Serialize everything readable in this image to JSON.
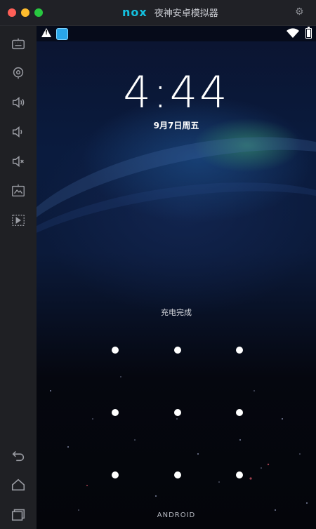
{
  "window": {
    "brand_logo": "nox",
    "title": "夜神安卓模拟器"
  },
  "sidebar": {
    "items": [
      {
        "icon": "keyboard-icon"
      },
      {
        "icon": "location-icon"
      },
      {
        "icon": "volume-up-icon"
      },
      {
        "icon": "volume-down-icon"
      },
      {
        "icon": "mute-icon"
      },
      {
        "icon": "screenshot-icon"
      },
      {
        "icon": "video-icon"
      },
      {
        "icon": "back-icon"
      },
      {
        "icon": "home-icon"
      },
      {
        "icon": "recent-apps-icon"
      }
    ]
  },
  "lockscreen": {
    "time": "4:44",
    "date": "9月7日周五",
    "charge_status": "充电完成",
    "footer": "ANDROID"
  },
  "colors": {
    "accent": "#14c0df",
    "titlebar_bg": "#202126",
    "sidebar_bg": "#1f2024"
  }
}
